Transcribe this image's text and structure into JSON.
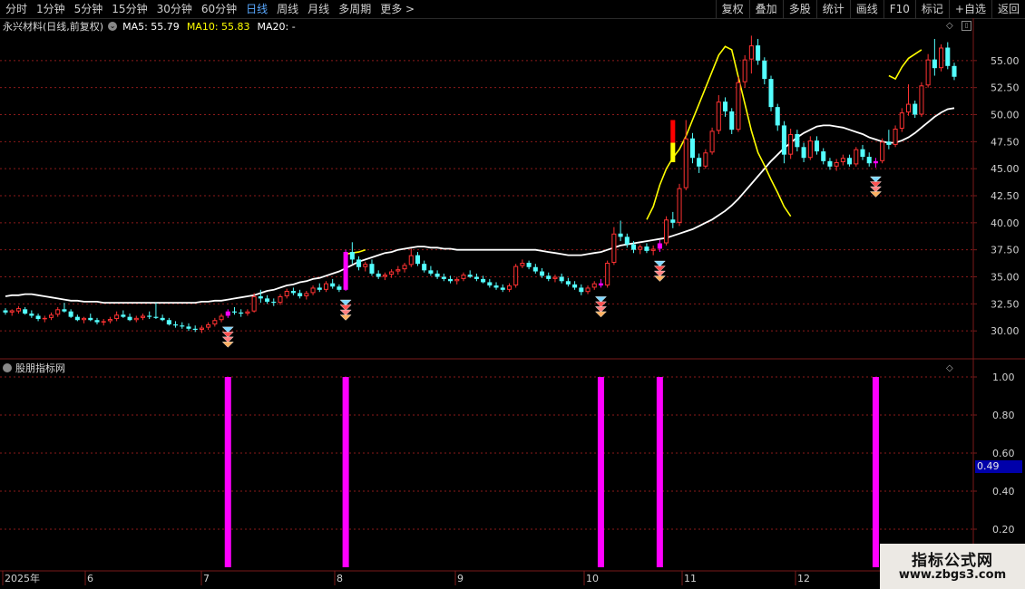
{
  "toolbar": {
    "periods": [
      "分时",
      "1分钟",
      "5分钟",
      "15分钟",
      "30分钟",
      "60分钟",
      "日线",
      "周线",
      "月线",
      "多周期",
      "更多 >"
    ],
    "active_period": "日线",
    "right_buttons": [
      "复权",
      "叠加",
      "多股",
      "统计",
      "画线",
      "F10",
      "+自选",
      "返回"
    ],
    "mark_button": "标记"
  },
  "main_chart": {
    "stock_label": "永兴材料(日线,前复权)",
    "ma5": "MA5: 55.79",
    "ma10": "MA10: 55.83",
    "ma20": "MA20: -",
    "y_ticks": [
      "55.00",
      "52.50",
      "50.00",
      "47.50",
      "45.00",
      "42.50",
      "40.00",
      "37.50",
      "35.00",
      "32.50",
      "30.00"
    ]
  },
  "indicator": {
    "title": "股朋指标网",
    "y_ticks": [
      "1.00",
      "0.80",
      "0.60",
      "0.40",
      "0.20"
    ],
    "current_value": "0.49"
  },
  "time_axis": {
    "labels": [
      "2025年",
      "6",
      "7",
      "8",
      "9",
      "10",
      "11",
      "12"
    ]
  },
  "watermark": {
    "title": "指标公式网",
    "url": "www.zbgs3.com"
  },
  "colors": {
    "up": "#ff3232",
    "down": "#54ffff",
    "ma_white": "#ffffff",
    "ma_yellow": "#ffff00",
    "signal": "#ff00ff",
    "grid": "#8b1a1a",
    "axis": "#7a1a1a",
    "active": "#5aa9ff"
  },
  "chart_data": {
    "type": "candlestick",
    "price_range": [
      27.5,
      57.5
    ],
    "candles": [
      [
        31.9,
        32.1,
        31.5,
        31.7
      ],
      [
        31.7,
        32.0,
        31.4,
        31.9
      ],
      [
        31.8,
        32.3,
        31.6,
        32.1
      ],
      [
        32.0,
        32.2,
        31.5,
        31.6
      ],
      [
        31.6,
        31.9,
        31.2,
        31.4
      ],
      [
        31.4,
        31.6,
        30.9,
        31.1
      ],
      [
        31.1,
        31.4,
        30.8,
        31.2
      ],
      [
        31.2,
        31.7,
        31.0,
        31.5
      ],
      [
        31.5,
        32.2,
        31.3,
        32.0
      ],
      [
        32.0,
        32.6,
        31.7,
        31.8
      ],
      [
        31.8,
        32.0,
        31.2,
        31.3
      ],
      [
        31.3,
        31.5,
        30.9,
        31.0
      ],
      [
        31.0,
        31.3,
        30.7,
        31.2
      ],
      [
        31.2,
        31.6,
        30.9,
        31.0
      ],
      [
        31.0,
        31.2,
        30.6,
        30.8
      ],
      [
        30.8,
        31.1,
        30.5,
        30.9
      ],
      [
        30.9,
        31.3,
        30.7,
        31.1
      ],
      [
        31.1,
        31.8,
        30.9,
        31.5
      ],
      [
        31.5,
        31.9,
        31.2,
        31.3
      ],
      [
        31.3,
        31.6,
        30.9,
        31.0
      ],
      [
        31.0,
        31.4,
        30.8,
        31.2
      ],
      [
        31.2,
        31.6,
        31.0,
        31.4
      ],
      [
        31.4,
        31.8,
        31.1,
        31.3
      ],
      [
        31.3,
        32.6,
        31.1,
        31.2
      ],
      [
        31.2,
        31.5,
        30.9,
        31.0
      ],
      [
        31.0,
        31.2,
        30.5,
        30.6
      ],
      [
        30.6,
        30.9,
        30.3,
        30.5
      ],
      [
        30.5,
        30.8,
        30.2,
        30.4
      ],
      [
        30.4,
        30.7,
        30.0,
        30.2
      ],
      [
        30.2,
        30.5,
        29.9,
        30.1
      ],
      [
        30.1,
        30.5,
        29.8,
        30.3
      ],
      [
        30.3,
        30.8,
        30.1,
        30.6
      ],
      [
        30.6,
        31.2,
        30.4,
        31.0
      ],
      [
        31.0,
        31.6,
        30.8,
        31.4
      ],
      [
        31.4,
        32.0,
        31.2,
        31.8
      ],
      [
        31.8,
        32.2,
        31.5,
        31.7
      ],
      [
        31.7,
        32.0,
        31.3,
        31.6
      ],
      [
        31.6,
        32.0,
        31.4,
        31.8
      ],
      [
        31.8,
        33.5,
        31.7,
        33.2
      ],
      [
        33.2,
        33.8,
        32.6,
        33.0
      ],
      [
        33.0,
        33.3,
        32.5,
        32.7
      ],
      [
        32.7,
        33.0,
        32.3,
        32.6
      ],
      [
        32.6,
        33.4,
        32.4,
        33.2
      ],
      [
        33.2,
        33.9,
        33.0,
        33.7
      ],
      [
        33.7,
        34.0,
        33.3,
        33.5
      ],
      [
        33.5,
        33.8,
        33.0,
        33.2
      ],
      [
        33.2,
        33.7,
        32.9,
        33.5
      ],
      [
        33.5,
        34.2,
        33.3,
        34.0
      ],
      [
        34.0,
        34.4,
        33.6,
        33.8
      ],
      [
        33.8,
        34.6,
        33.6,
        34.4
      ],
      [
        34.4,
        34.8,
        33.9,
        34.1
      ],
      [
        34.1,
        34.3,
        33.6,
        33.8
      ],
      [
        33.8,
        37.5,
        33.7,
        37.3
      ],
      [
        37.3,
        38.2,
        36.2,
        36.6
      ],
      [
        36.6,
        36.9,
        35.6,
        35.9
      ],
      [
        35.9,
        36.4,
        35.5,
        36.2
      ],
      [
        36.2,
        36.6,
        35.1,
        35.3
      ],
      [
        35.3,
        35.6,
        34.8,
        35.0
      ],
      [
        35.0,
        35.4,
        34.7,
        35.2
      ],
      [
        35.2,
        35.7,
        34.9,
        35.5
      ],
      [
        35.5,
        36.0,
        35.2,
        35.7
      ],
      [
        35.7,
        36.3,
        35.4,
        36.1
      ],
      [
        36.1,
        37.6,
        35.9,
        37.0
      ],
      [
        37.0,
        37.3,
        36.0,
        36.2
      ],
      [
        36.2,
        36.5,
        35.4,
        35.6
      ],
      [
        35.6,
        36.0,
        35.1,
        35.3
      ],
      [
        35.3,
        35.6,
        34.8,
        35.0
      ],
      [
        35.0,
        35.3,
        34.6,
        34.8
      ],
      [
        34.8,
        35.1,
        34.4,
        34.6
      ],
      [
        34.6,
        35.0,
        34.3,
        34.8
      ],
      [
        34.8,
        35.4,
        34.6,
        35.2
      ],
      [
        35.2,
        35.6,
        34.9,
        35.0
      ],
      [
        35.0,
        35.3,
        34.6,
        34.8
      ],
      [
        34.8,
        35.1,
        34.4,
        34.5
      ],
      [
        34.5,
        34.8,
        34.0,
        34.2
      ],
      [
        34.2,
        34.5,
        33.8,
        34.0
      ],
      [
        34.0,
        34.3,
        33.6,
        33.8
      ],
      [
        33.8,
        34.4,
        33.6,
        34.2
      ],
      [
        34.2,
        36.2,
        34.0,
        36.0
      ],
      [
        36.0,
        36.6,
        35.8,
        36.3
      ],
      [
        36.3,
        36.5,
        35.7,
        35.9
      ],
      [
        35.9,
        36.2,
        35.3,
        35.5
      ],
      [
        35.5,
        35.8,
        34.9,
        35.1
      ],
      [
        35.1,
        35.4,
        34.6,
        34.8
      ],
      [
        34.8,
        35.2,
        34.5,
        35.0
      ],
      [
        35.0,
        35.3,
        34.4,
        34.6
      ],
      [
        34.6,
        34.9,
        34.1,
        34.3
      ],
      [
        34.3,
        34.6,
        33.8,
        34.0
      ],
      [
        34.0,
        34.3,
        33.3,
        33.6
      ],
      [
        33.6,
        34.2,
        33.4,
        34.0
      ],
      [
        34.0,
        34.6,
        33.8,
        34.4
      ],
      [
        34.4,
        34.8,
        34.0,
        34.2
      ],
      [
        34.2,
        36.5,
        34.0,
        36.3
      ],
      [
        36.3,
        39.6,
        36.1,
        39.0
      ],
      [
        39.0,
        40.2,
        38.3,
        38.7
      ],
      [
        38.7,
        39.0,
        37.7,
        38.0
      ],
      [
        38.0,
        38.3,
        37.2,
        37.5
      ],
      [
        37.5,
        38.0,
        37.1,
        37.8
      ],
      [
        37.8,
        38.1,
        37.2,
        37.4
      ],
      [
        37.4,
        37.9,
        37.0,
        37.6
      ],
      [
        37.6,
        38.4,
        37.3,
        38.1
      ],
      [
        38.1,
        40.6,
        37.9,
        40.3
      ],
      [
        40.3,
        41.0,
        39.5,
        40.0
      ],
      [
        40.0,
        43.6,
        39.7,
        43.2
      ],
      [
        43.2,
        49.5,
        43.0,
        47.8
      ],
      [
        47.8,
        48.3,
        45.5,
        46.0
      ],
      [
        46.0,
        46.4,
        44.6,
        45.2
      ],
      [
        45.2,
        46.8,
        45.0,
        46.5
      ],
      [
        46.5,
        48.8,
        46.3,
        48.5
      ],
      [
        48.5,
        51.8,
        48.2,
        51.2
      ],
      [
        51.2,
        51.6,
        49.8,
        50.3
      ],
      [
        50.3,
        50.6,
        48.2,
        48.6
      ],
      [
        48.6,
        53.5,
        48.4,
        53.0
      ],
      [
        53.0,
        55.5,
        52.5,
        55.1
      ],
      [
        55.1,
        57.3,
        53.8,
        56.4
      ],
      [
        56.4,
        57.0,
        54.6,
        55.0
      ],
      [
        55.0,
        55.3,
        52.8,
        53.3
      ],
      [
        53.3,
        53.6,
        50.3,
        50.7
      ],
      [
        50.7,
        51.0,
        48.5,
        49.0
      ],
      [
        49.0,
        49.4,
        45.5,
        46.3
      ],
      [
        46.3,
        48.7,
        45.9,
        48.2
      ],
      [
        48.2,
        48.6,
        46.6,
        47.0
      ],
      [
        47.0,
        47.4,
        45.6,
        46.0
      ],
      [
        46.0,
        48.0,
        45.8,
        47.6
      ],
      [
        47.6,
        48.0,
        46.3,
        46.6
      ],
      [
        46.6,
        46.9,
        45.4,
        45.7
      ],
      [
        45.7,
        46.0,
        44.9,
        45.2
      ],
      [
        45.2,
        45.9,
        44.8,
        45.6
      ],
      [
        45.6,
        46.3,
        45.3,
        46.0
      ],
      [
        46.0,
        46.3,
        45.2,
        45.4
      ],
      [
        45.4,
        47.0,
        45.2,
        46.8
      ],
      [
        46.8,
        47.2,
        45.8,
        46.1
      ],
      [
        46.1,
        46.5,
        45.2,
        45.5
      ],
      [
        45.5,
        46.0,
        45.1,
        45.7
      ],
      [
        45.7,
        47.8,
        45.5,
        47.5
      ],
      [
        47.5,
        48.6,
        46.8,
        47.2
      ],
      [
        47.2,
        49.0,
        47.0,
        48.7
      ],
      [
        48.7,
        50.6,
        48.4,
        50.2
      ],
      [
        50.2,
        52.8,
        49.9,
        51.0
      ],
      [
        51.0,
        51.3,
        49.7,
        50.0
      ],
      [
        50.0,
        53.0,
        49.8,
        52.7
      ],
      [
        52.7,
        55.6,
        52.5,
        55.1
      ],
      [
        55.1,
        57.0,
        53.6,
        54.3
      ],
      [
        54.3,
        56.5,
        54.0,
        56.2
      ],
      [
        56.2,
        56.7,
        54.2,
        54.5
      ],
      [
        54.5,
        54.8,
        53.2,
        53.5
      ]
    ],
    "ma_white": [
      33.2,
      33.3,
      33.3,
      33.4,
      33.4,
      33.3,
      33.2,
      33.1,
      33.0,
      32.9,
      32.8,
      32.8,
      32.7,
      32.7,
      32.7,
      32.6,
      32.6,
      32.6,
      32.6,
      32.6,
      32.6,
      32.6,
      32.6,
      32.6,
      32.6,
      32.6,
      32.6,
      32.6,
      32.6,
      32.6,
      32.7,
      32.7,
      32.8,
      32.8,
      32.9,
      33.0,
      33.1,
      33.2,
      33.3,
      33.5,
      33.7,
      33.8,
      34.0,
      34.2,
      34.3,
      34.5,
      34.6,
      34.8,
      34.9,
      35.1,
      35.3,
      35.5,
      35.8,
      36.1,
      36.4,
      36.6,
      36.8,
      37.0,
      37.2,
      37.3,
      37.5,
      37.6,
      37.7,
      37.8,
      37.8,
      37.7,
      37.7,
      37.6,
      37.6,
      37.5,
      37.5,
      37.5,
      37.5,
      37.5,
      37.5,
      37.5,
      37.5,
      37.5,
      37.5,
      37.5,
      37.5,
      37.5,
      37.4,
      37.3,
      37.2,
      37.1,
      37.0,
      37.0,
      37.0,
      37.1,
      37.2,
      37.3,
      37.5,
      37.7,
      37.9,
      38.0,
      38.1,
      38.2,
      38.3,
      38.4,
      38.5,
      38.6,
      38.8,
      39.0,
      39.2,
      39.4,
      39.7,
      40.0,
      40.3,
      40.7,
      41.1,
      41.6,
      42.2,
      42.9,
      43.6,
      44.3,
      45.0,
      45.7,
      46.3,
      46.9,
      47.4,
      47.9,
      48.3,
      48.6,
      48.9,
      49.0,
      49.0,
      48.9,
      48.8,
      48.6,
      48.4,
      48.2,
      47.9,
      47.7,
      47.5,
      47.4,
      47.4,
      47.6,
      47.9,
      48.3,
      48.8,
      49.3,
      49.8,
      50.2,
      50.5,
      50.6
    ],
    "ma_yellow": [
      {
        "i": 52,
        "v": 37.1
      },
      {
        "i": 53,
        "v": 37.2
      },
      {
        "i": 54,
        "v": 37.3
      },
      {
        "i": 55,
        "v": 37.5
      },
      {
        "i": 98,
        "v": 40.3
      },
      {
        "i": 99,
        "v": 41.5
      },
      {
        "i": 100,
        "v": 43.5
      },
      {
        "i": 101,
        "v": 45.0
      },
      {
        "i": 102,
        "v": 46.0
      },
      {
        "i": 103,
        "v": 46.8
      },
      {
        "i": 104,
        "v": 48.0
      },
      {
        "i": 105,
        "v": 49.5
      },
      {
        "i": 106,
        "v": 51.0
      },
      {
        "i": 107,
        "v": 52.5
      },
      {
        "i": 108,
        "v": 54.0
      },
      {
        "i": 109,
        "v": 55.5
      },
      {
        "i": 110,
        "v": 56.3
      },
      {
        "i": 111,
        "v": 56.0
      },
      {
        "i": 112,
        "v": 53.5
      },
      {
        "i": 113,
        "v": 51.0
      },
      {
        "i": 114,
        "v": 48.5
      },
      {
        "i": 115,
        "v": 46.5
      },
      {
        "i": 116,
        "v": 45.3
      },
      {
        "i": 117,
        "v": 44.0
      },
      {
        "i": 118,
        "v": 42.8
      },
      {
        "i": 119,
        "v": 41.5
      },
      {
        "i": 120,
        "v": 40.6
      },
      {
        "i": 135,
        "v": 53.6
      },
      {
        "i": 136,
        "v": 53.3
      },
      {
        "i": 137,
        "v": 54.4
      },
      {
        "i": 138,
        "v": 55.2
      },
      {
        "i": 139,
        "v": 55.6
      },
      {
        "i": 140,
        "v": 56.0
      }
    ],
    "signals": [
      34,
      52,
      91,
      100,
      133
    ],
    "indicator_values": [
      1,
      1,
      1,
      1,
      1
    ]
  }
}
